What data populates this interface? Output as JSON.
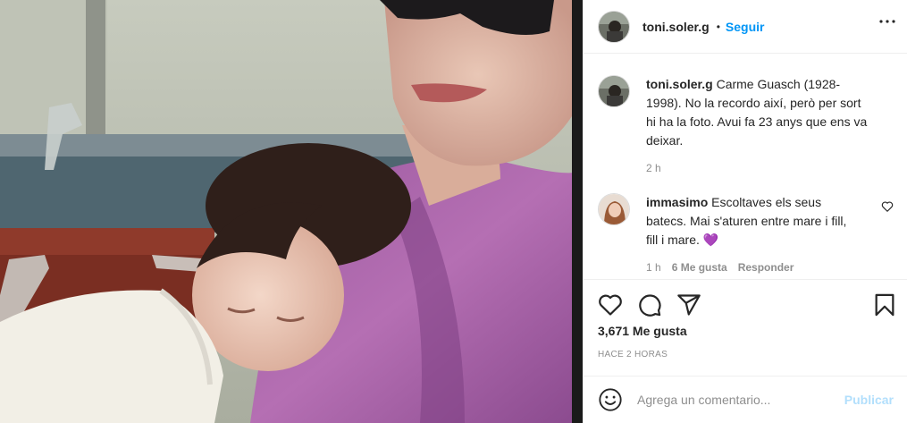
{
  "post": {
    "username": "toni.soler.g",
    "separator": "•",
    "follow_label": "Seguir"
  },
  "caption": {
    "author": "toni.soler.g",
    "text": "Carme Guasch (1928-1998). No la recordo així, però per sort hi ha la foto. Avui fa 23 anys que ens va deixar.",
    "time": "2 h"
  },
  "comments": [
    {
      "author": "immasimo",
      "text": "Escoltaves els seus batecs. Mai s'aturen entre mare i fill, fill i mare.",
      "emoji": "💜",
      "time": "1 h",
      "likes": "6 Me gusta",
      "reply_label": "Responder"
    }
  ],
  "stats": {
    "likes": "3,671 Me gusta",
    "time_ago": "HACE 2 HORAS"
  },
  "composer": {
    "placeholder": "Agrega un comentario...",
    "publish_label": "Publicar"
  },
  "icons": {
    "more": "more-horizontal-icon",
    "like": "heart-icon",
    "comment": "comment-icon",
    "share": "paper-plane-icon",
    "save": "bookmark-icon",
    "emoji": "smiley-icon",
    "comment_like": "small-heart-icon"
  },
  "colors": {
    "follow": "#0095f6",
    "publish_disabled": "#b2dffc",
    "muted": "#8e8e8e",
    "emoji_heart": "#8a5cd6"
  }
}
